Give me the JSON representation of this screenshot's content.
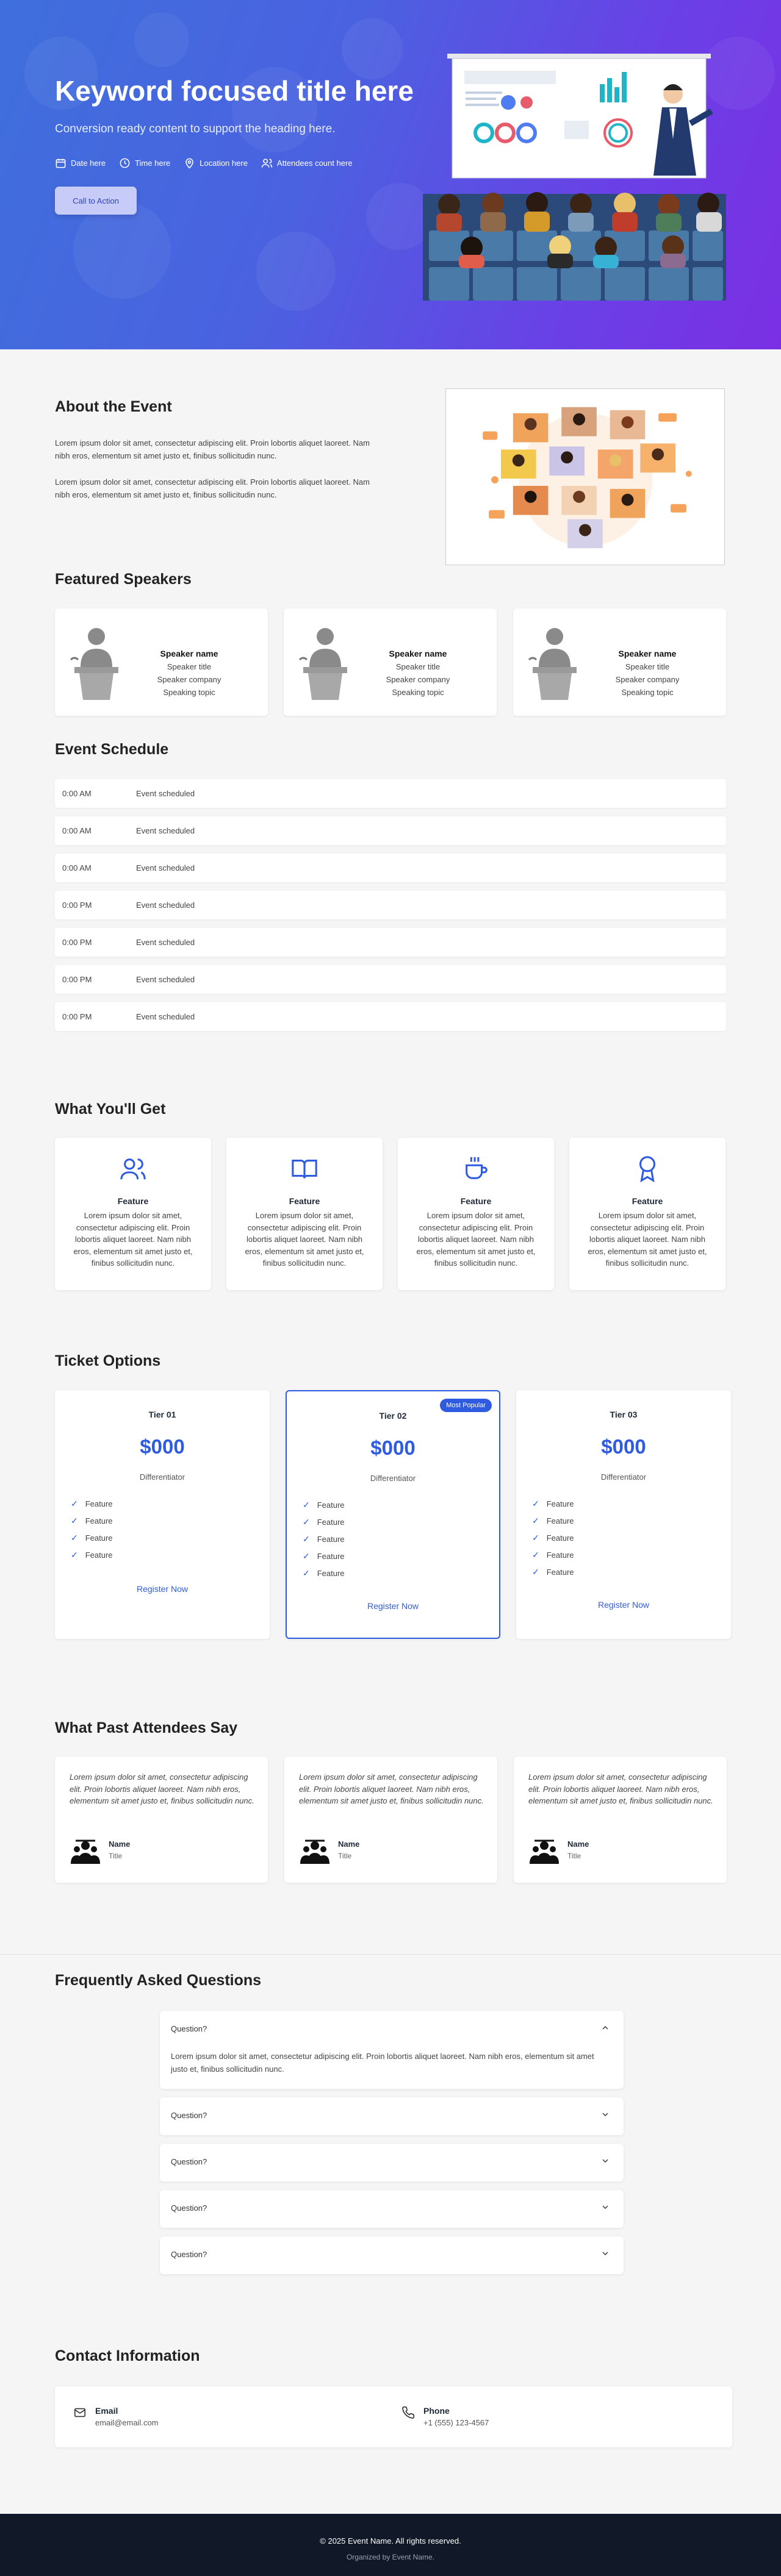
{
  "hero": {
    "title": "Keyword focused title here",
    "subtitle": "Conversion ready content to support the heading here.",
    "meta": [
      "Date here",
      "Time here",
      "Location here",
      "Attendees count here"
    ],
    "cta": "Call to Action",
    "gradient": [
      "#3f6fdc",
      "#7b2fe4"
    ]
  },
  "about": {
    "title": "About the Event",
    "p1": "Lorem ipsum dolor sit amet, consectetur adipiscing elit. Proin lobortis aliquet laoreet. Nam nibh eros, elementum sit amet justo et, finibus sollicitudin nunc.",
    "p2": "Lorem ipsum dolor sit amet, consectetur adipiscing elit. Proin lobortis aliquet laoreet. Nam nibh eros, elementum sit amet justo et, finibus sollicitudin nunc."
  },
  "speakers": {
    "title": "Featured Speakers",
    "items": [
      {
        "name": "Speaker name",
        "title": "Speaker title",
        "company": "Speaker company",
        "topic": "Speaking topic"
      },
      {
        "name": "Speaker name",
        "title": "Speaker title",
        "company": "Speaker company",
        "topic": "Speaking topic"
      },
      {
        "name": "Speaker name",
        "title": "Speaker title",
        "company": "Speaker company",
        "topic": "Speaking topic"
      }
    ]
  },
  "schedule": {
    "title": "Event Schedule",
    "rows": [
      {
        "time": "0:00 AM",
        "event": "Event scheduled"
      },
      {
        "time": "0:00 AM",
        "event": "Event scheduled"
      },
      {
        "time": "0:00 AM",
        "event": "Event scheduled"
      },
      {
        "time": "0:00 PM",
        "event": "Event scheduled"
      },
      {
        "time": "0:00 PM",
        "event": "Event scheduled"
      },
      {
        "time": "0:00 PM",
        "event": "Event scheduled"
      },
      {
        "time": "0:00 PM",
        "event": "Event scheduled"
      }
    ]
  },
  "benefits": {
    "title": "What You'll Get",
    "items": [
      {
        "icon": "users-icon",
        "title": "Feature",
        "text": "Lorem ipsum dolor sit amet, consectetur adipiscing elit. Proin lobortis aliquet laoreet. Nam nibh eros, elementum sit amet justo et, finibus sollicitudin nunc."
      },
      {
        "icon": "book-icon",
        "title": "Feature",
        "text": "Lorem ipsum dolor sit amet, consectetur adipiscing elit. Proin lobortis aliquet laoreet. Nam nibh eros, elementum sit amet justo et, finibus sollicitudin nunc."
      },
      {
        "icon": "coffee-icon",
        "title": "Feature",
        "text": "Lorem ipsum dolor sit amet, consectetur adipiscing elit. Proin lobortis aliquet laoreet. Nam nibh eros, elementum sit amet justo et, finibus sollicitudin nunc."
      },
      {
        "icon": "award-icon",
        "title": "Feature",
        "text": "Lorem ipsum dolor sit amet, consectetur adipiscing elit. Proin lobortis aliquet laoreet. Nam nibh eros, elementum sit amet justo et, finibus sollicitudin nunc."
      }
    ]
  },
  "tickets": {
    "title": "Ticket Options",
    "badge": "Most Popular",
    "tiers": [
      {
        "name": "Tier 01",
        "price": "$000",
        "diff": "Differentiator",
        "features": [
          "Feature",
          "Feature",
          "Feature",
          "Feature"
        ],
        "cta": "Register Now"
      },
      {
        "name": "Tier 02",
        "price": "$000",
        "diff": "Differentiator",
        "features": [
          "Feature",
          "Feature",
          "Feature",
          "Feature",
          "Feature"
        ],
        "cta": "Register Now"
      },
      {
        "name": "Tier 03",
        "price": "$000",
        "diff": "Differentiator",
        "features": [
          "Feature",
          "Feature",
          "Feature",
          "Feature",
          "Feature"
        ],
        "cta": "Register Now"
      }
    ],
    "accent": "#2f5be0"
  },
  "testimonials": {
    "title": "What Past Attendees Say",
    "items": [
      {
        "quote": "Lorem ipsum dolor sit amet, consectetur adipiscing elit. Proin lobortis aliquet laoreet. Nam nibh eros, elementum sit amet justo et, finibus sollicitudin nunc.",
        "name": "Name",
        "title": "Title"
      },
      {
        "quote": "Lorem ipsum dolor sit amet, consectetur adipiscing elit. Proin lobortis aliquet laoreet. Nam nibh eros, elementum sit amet justo et, finibus sollicitudin nunc.",
        "name": "Name",
        "title": "Title"
      },
      {
        "quote": "Lorem ipsum dolor sit amet, consectetur adipiscing elit. Proin lobortis aliquet laoreet. Nam nibh eros, elementum sit amet justo et, finibus sollicitudin nunc.",
        "name": "Name",
        "title": "Title"
      }
    ]
  },
  "faq": {
    "title": "Frequently Asked Questions",
    "items": [
      {
        "q": "Question?",
        "a": "Lorem ipsum dolor sit amet, consectetur adipiscing elit. Proin lobortis aliquet laoreet. Nam nibh eros, elementum sit amet justo et, finibus sollicitudin nunc.",
        "open": true
      },
      {
        "q": "Question?",
        "a": "",
        "open": false
      },
      {
        "q": "Question?",
        "a": "",
        "open": false
      },
      {
        "q": "Question?",
        "a": "",
        "open": false
      },
      {
        "q": "Question?",
        "a": "",
        "open": false
      }
    ]
  },
  "contact": {
    "title": "Contact Information",
    "email_label": "Email",
    "email": "email@email.com",
    "phone_label": "Phone",
    "phone": "+1 (555) 123-4567"
  },
  "footer": {
    "copyright": "© 2025 Event Name. All rights reserved.",
    "organizer": "Organized by Event Name."
  }
}
